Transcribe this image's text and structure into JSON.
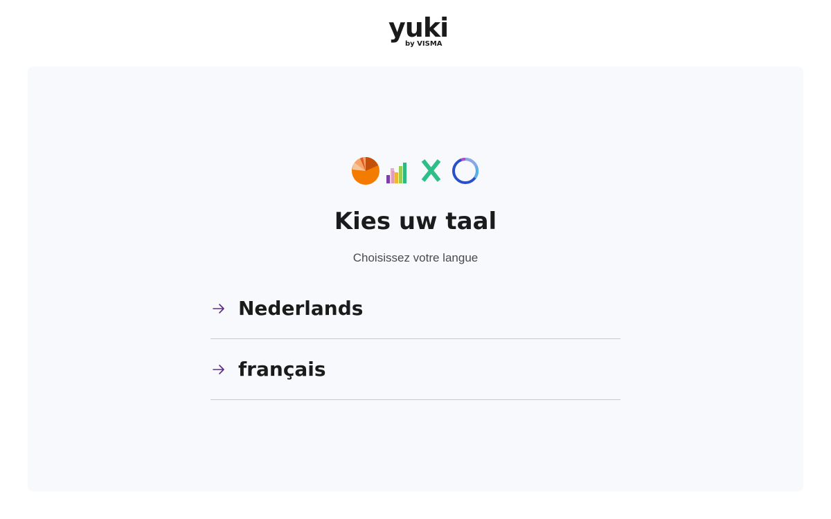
{
  "header": {
    "logo_text": "yuki",
    "logo_subtext": "by VISMA"
  },
  "main": {
    "illustration_icons": [
      "pie-chart-icon",
      "bar-chart-icon",
      "cross-icon",
      "ring-chart-icon"
    ],
    "title": "Kies uw taal",
    "subtitle": "Choisissez votre langue",
    "languages": [
      {
        "label": "Nederlands",
        "icon": "arrow-right-icon"
      },
      {
        "label": "français",
        "icon": "arrow-right-icon"
      }
    ]
  },
  "colors": {
    "accent_arrow": "#5b2a86",
    "divider": "#cdc6d2",
    "panel_background": "#f7f9fd",
    "text": "#1b1b1b"
  }
}
